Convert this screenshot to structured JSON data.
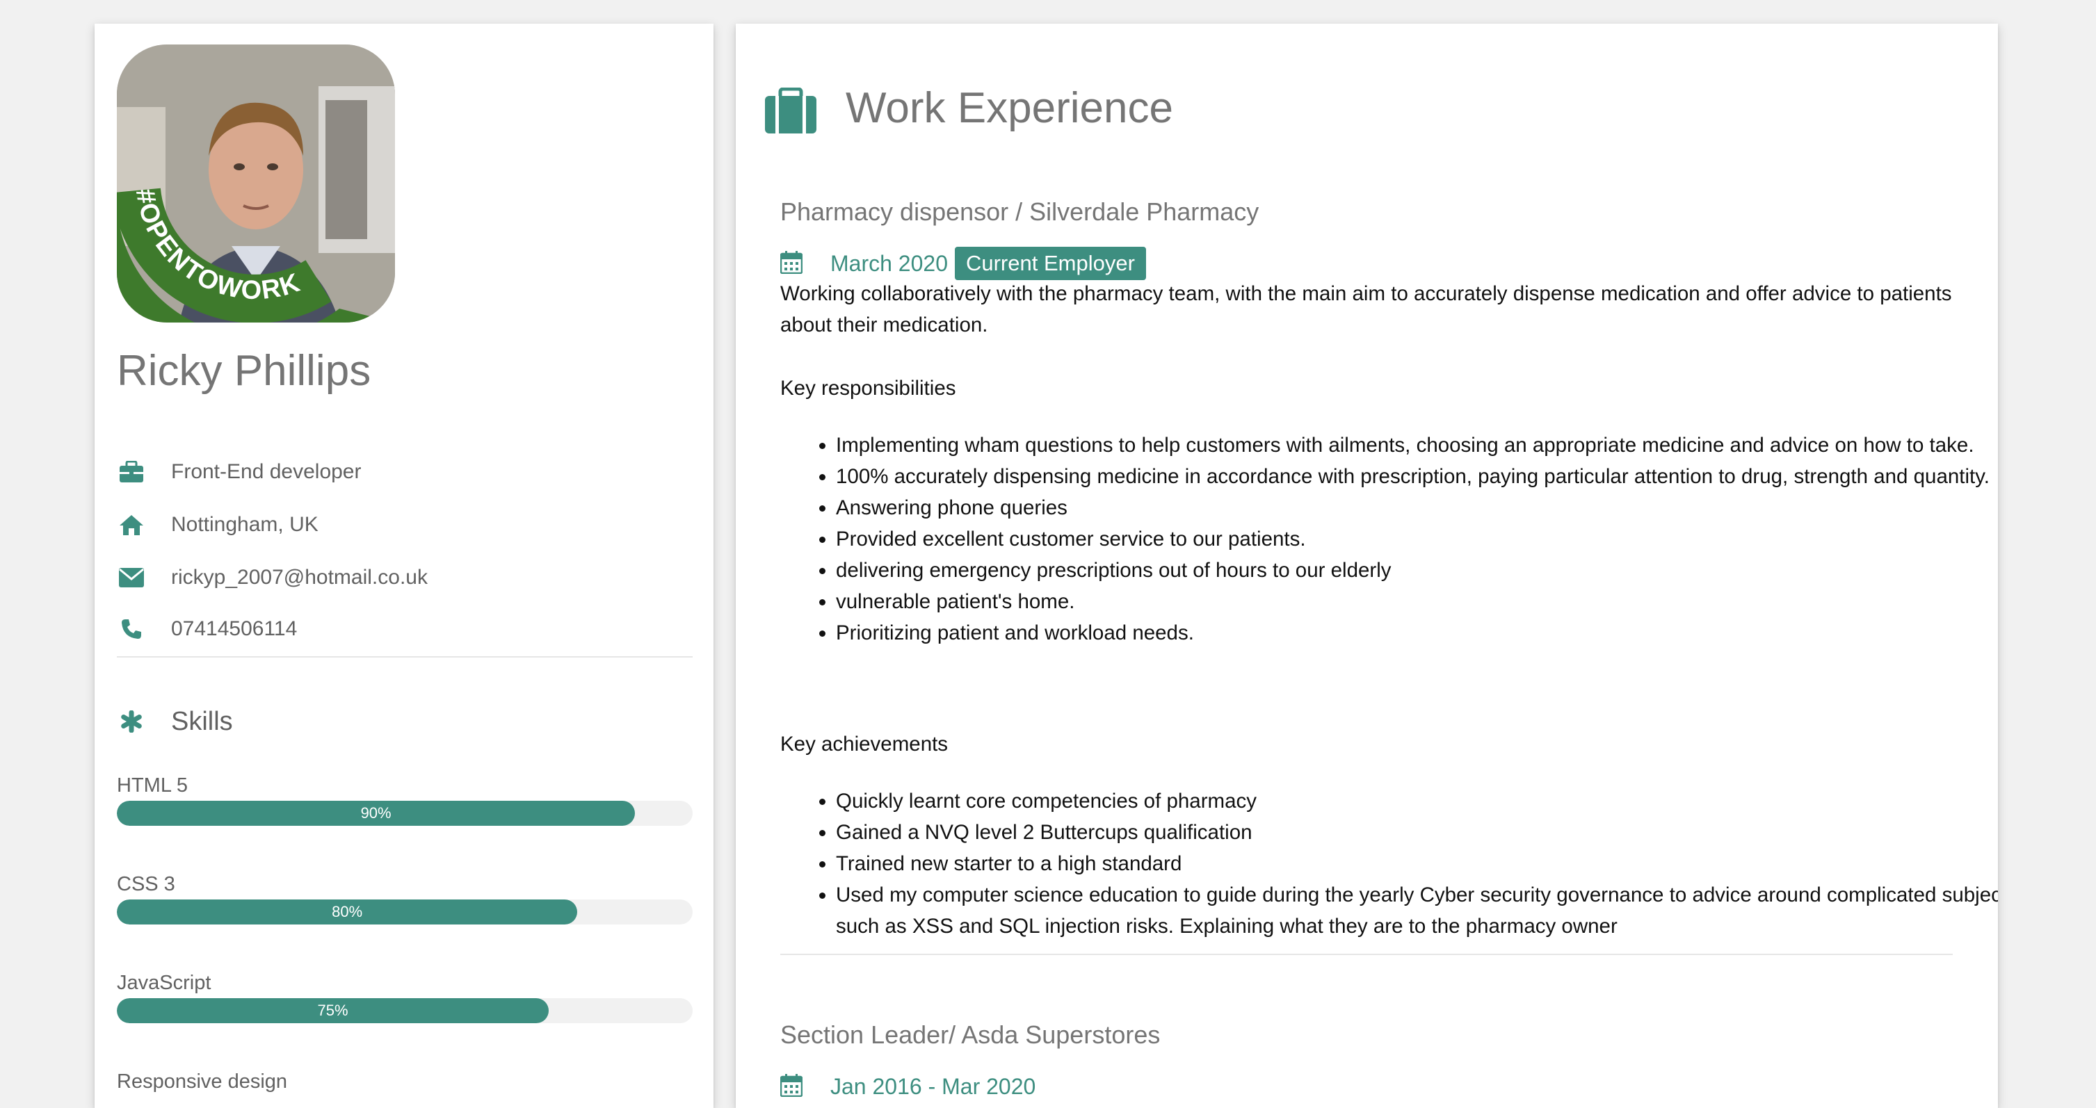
{
  "profile": {
    "name": "Ricky Phillips",
    "avatar_badge": "#OPENTOWORK",
    "job": "Front-End developer",
    "location": "Nottingham, UK",
    "email": "rickyp_2007@hotmail.co.uk",
    "phone": "07414506114",
    "accent_color": "#3d8e80"
  },
  "skills": {
    "heading": "Skills",
    "items": [
      {
        "name": "HTML 5",
        "percent": 90,
        "label": "90%"
      },
      {
        "name": "CSS 3",
        "percent": 80,
        "label": "80%"
      },
      {
        "name": "JavaScript",
        "percent": 75,
        "label": "75%"
      },
      {
        "name": "Responsive design"
      }
    ]
  },
  "work": {
    "heading": "Work Experience",
    "jobs": [
      {
        "title": "Pharmacy dispensor / Silverdale Pharmacy",
        "date": "March 2020",
        "badge": "Current Employer",
        "description": "Working collaboratively with the pharmacy team, with the main aim to accurately dispense medication and offer advice to patients about their medication.",
        "responsibilities_heading": "Key responsibilities",
        "responsibilities": [
          "Implementing wham questions to help customers with ailments, choosing an appropriate medicine and advice on how to take.",
          "100% accurately dispensing medicine in accordance with prescription, paying particular attention to drug, strength and quantity.",
          "Answering phone queries",
          "Provided excellent customer service to our patients.",
          "delivering emergency prescriptions out of hours to our elderly",
          "vulnerable patient's home.",
          "Prioritizing patient and workload needs."
        ],
        "achievements_heading": "Key achievements",
        "achievements": [
          "Quickly learnt core competencies of pharmacy",
          "Gained a NVQ level 2 Buttercups qualification",
          "Trained new starter to a high standard",
          "Used my computer science education to guide during the yearly Cyber security governance to advice around complicated subjects such as XSS and SQL injection risks. Explaining what they are to the pharmacy owner"
        ]
      },
      {
        "title": "Section Leader/ Asda Superstores",
        "date": "Jan 2016 - Mar 2020"
      }
    ]
  }
}
